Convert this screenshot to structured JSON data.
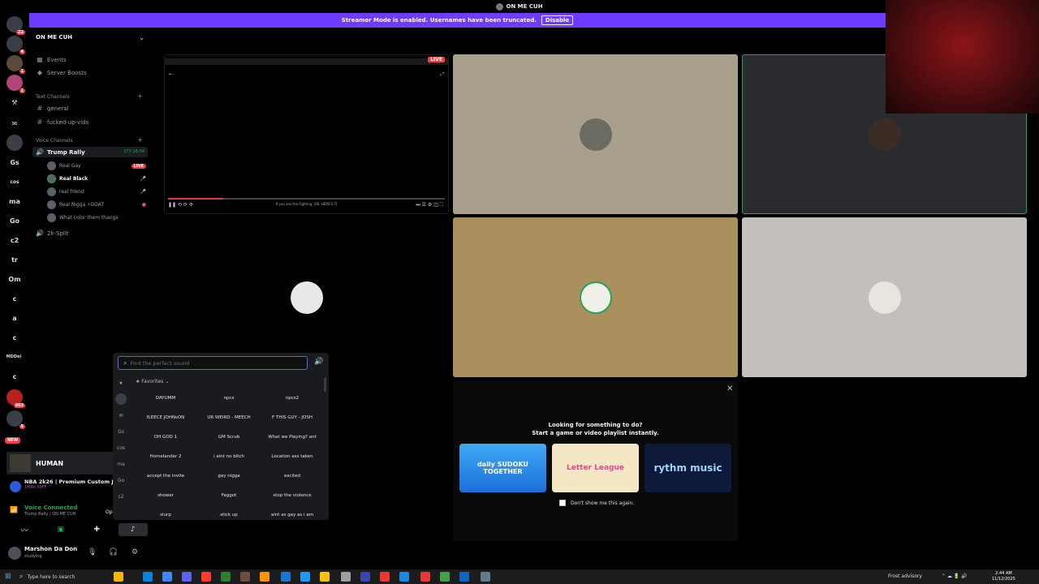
{
  "window": {
    "title": "ON ME CUH"
  },
  "banner": {
    "text": "Streamer Mode is enabled. Usernames have been truncated.",
    "button": "Disable"
  },
  "rail": {
    "items": [
      {
        "label": "",
        "badge": "22"
      },
      {
        "label": "",
        "badge": "4"
      },
      {
        "label": "",
        "badge": "1"
      },
      {
        "label": "",
        "badge": "1"
      },
      {
        "label": "",
        "badge": ""
      },
      {
        "label": "",
        "badge": ""
      },
      {
        "label": "",
        "badge": ""
      },
      {
        "label": "Gs",
        "badge": ""
      },
      {
        "label": "cos",
        "badge": ""
      },
      {
        "label": "ma",
        "badge": ""
      },
      {
        "label": "Go",
        "badge": ""
      },
      {
        "label": "c2",
        "badge": ""
      },
      {
        "label": "tr",
        "badge": ""
      },
      {
        "label": "Om",
        "badge": ""
      },
      {
        "label": "c",
        "badge": ""
      },
      {
        "label": "a",
        "badge": ""
      },
      {
        "label": "c",
        "badge": ""
      },
      {
        "label": "MDDel",
        "badge": ""
      },
      {
        "label": "c",
        "badge": ""
      },
      {
        "label": "",
        "badge": "863"
      },
      {
        "label": "",
        "badge": "5"
      }
    ],
    "new_badge": "NEW"
  },
  "server": {
    "name": "ON ME CUH"
  },
  "sidebar": {
    "events": "Events",
    "boosts": "Server Boosts",
    "text_category": "Text Channels",
    "text_channels": [
      "general",
      "fucked-up-vids"
    ],
    "voice_category": "Voice Channels",
    "active_voice": {
      "name": "Trump Rally",
      "timer": "177:16:04"
    },
    "members": [
      {
        "name": "Real Gay",
        "tag": "LIVE"
      },
      {
        "name": "Real Black",
        "tag": ""
      },
      {
        "name": "real friend",
        "tag": ""
      },
      {
        "name": "Real Nigga ⚡GOAT",
        "tag": ""
      },
      {
        "name": "What color them thangs",
        "tag": ""
      }
    ],
    "other_voice": "2k-Split"
  },
  "user_panel": {
    "activity_label": "HUMAN",
    "game_title": "NBA 2k26 | Premium Custom Ju",
    "game_sub": "1MAo 69FF",
    "voice_status": "Voice Connected",
    "voice_location": "Trump Rally / ON ME CUH",
    "open_soundboard": "Open Soundboard",
    "username": "Marshon Da Don",
    "user_status": "studying"
  },
  "stream": {
    "live": "LIVE",
    "caption": "If you see the Fighting. VIS. HERE'S TI",
    "progress_pct": 20
  },
  "soundboard": {
    "placeholder": "Find the perfect sound",
    "favorites_label": "Favorites",
    "rail_labels": [
      "Gs",
      "cos",
      "ma",
      "Go",
      "c2"
    ],
    "sounds": [
      "DAYUMM",
      "npcs",
      "npcs2",
      "fLEECE JOHNsON",
      "UR WEIRD - MEECH",
      "F THIS GUY - JOSH",
      "OH GOD 1",
      "GM Scrub",
      "What we Playing? ant",
      "Homelander 2",
      "i aint no bitch",
      "Location ass taken",
      "accept the invite",
      "gay nigga",
      "excited",
      "shower",
      "Faggot",
      "stop the violence",
      "slurp",
      "stick up",
      "aint as gay as i am"
    ]
  },
  "launcher": {
    "title_line1": "Looking for something to do?",
    "title_line2": "Start a game or video playlist instantly.",
    "cards": [
      "daily SUDOKU TOGETHER",
      "Letter League",
      "rythm music"
    ],
    "dont_show": "Don't show me this again."
  },
  "taskbar": {
    "search_placeholder": "Type here to search",
    "weather": "Frost advisory",
    "time": "2:44 AM",
    "date": "11/12/2025"
  },
  "colors": {
    "accent": "#6f3bff",
    "live": "#f23f43",
    "speaking": "#23a55a",
    "brand": "#5865f2"
  }
}
